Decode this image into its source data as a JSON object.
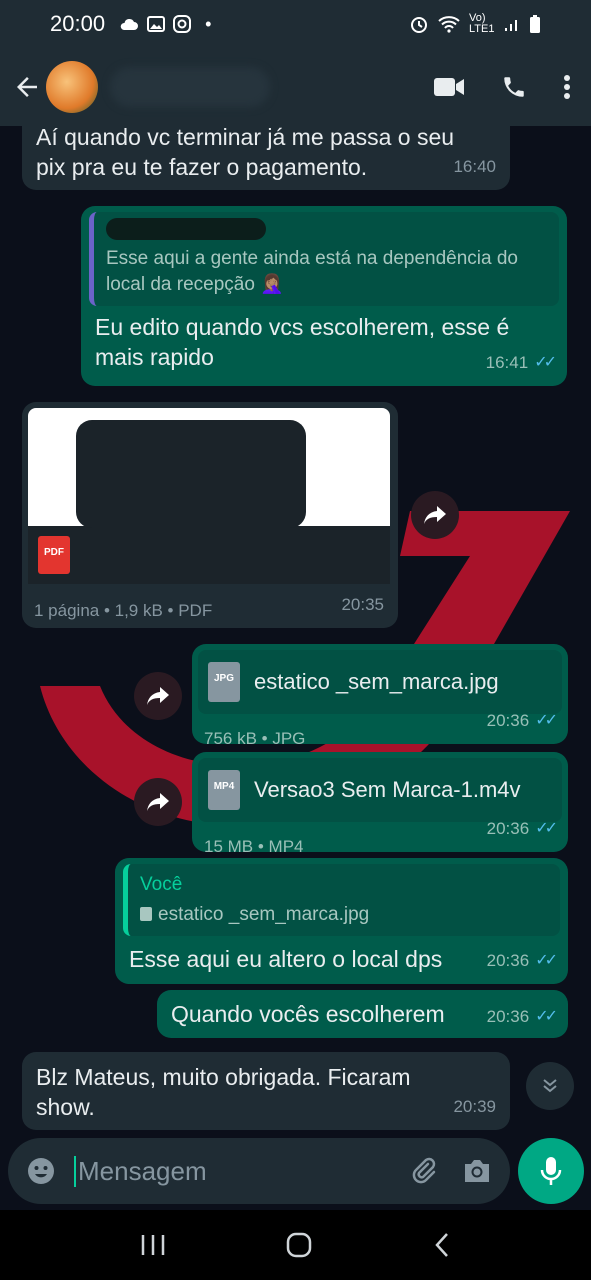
{
  "status_bar": {
    "time": "20:00",
    "network": "Vo) LTE1"
  },
  "chat": {
    "messages": [
      {
        "text": "Aí quando vc terminar já me passa o seu pix pra eu te fazer o pagamento.",
        "time": "16:40"
      },
      {
        "quote_text": "Esse aqui a gente ainda está na dependência do local da recepção 🤦🏽‍♀️",
        "text": "Eu edito  quando vcs escolherem, esse é mais rapido",
        "time": "16:41"
      },
      {
        "pdf_label": "PDF",
        "meta": "1 página • 1,9 kB • PDF",
        "time": "20:35"
      },
      {
        "file_type": "JPG",
        "file_name": "estatico _sem_marca.jpg",
        "meta": "756 kB • JPG",
        "time": "20:36"
      },
      {
        "file_type": "MP4",
        "file_name": "Versao3 Sem Marca-1.m4v",
        "meta": "15 MB • MP4",
        "time": "20:36"
      },
      {
        "quote_author": "Você",
        "quote_file": "estatico _sem_marca.jpg",
        "text": "Esse aqui eu altero o local dps",
        "time": "20:36"
      },
      {
        "text": "Quando vocês escolherem",
        "time": "20:36"
      },
      {
        "text": "Blz Mateus, muito obrigada. Ficaram show.",
        "time": "20:39"
      }
    ]
  },
  "composer": {
    "placeholder": "Mensagem"
  },
  "colors": {
    "incoming": "#1f2c34",
    "outgoing": "#005c4b",
    "accent": "#00a884",
    "read_ticks": "#53bdeb"
  },
  "icons": [
    "back-arrow-icon",
    "video-call-icon",
    "phone-icon",
    "more-icon",
    "forward-icon",
    "emoji-icon",
    "attach-icon",
    "camera-icon",
    "mic-icon",
    "scroll-down-icon"
  ]
}
